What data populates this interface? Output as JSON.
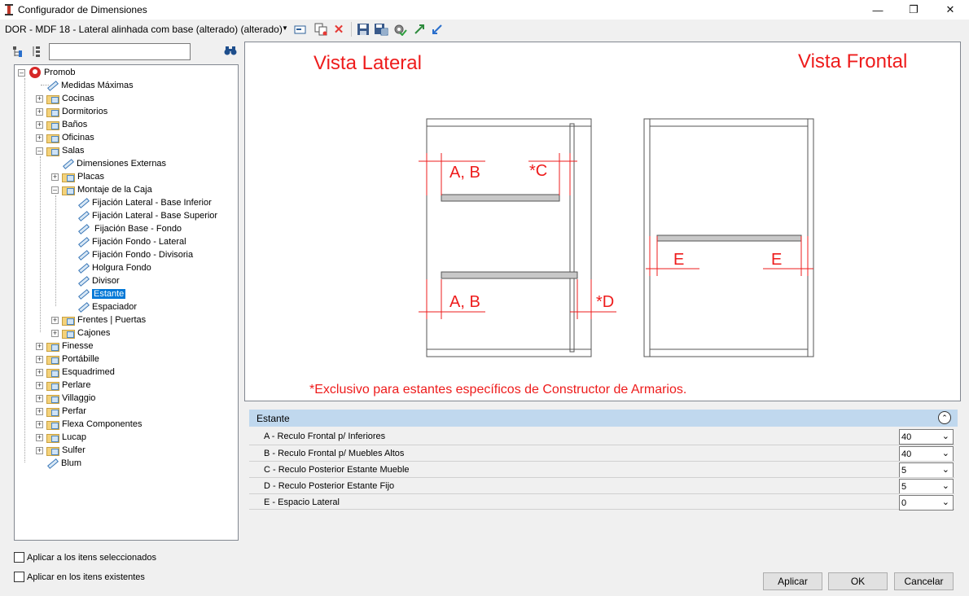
{
  "window": {
    "title": "Configurador de Dimensiones",
    "min_icon": "minimize-icon",
    "max_icon": "restore-icon",
    "close_icon": "close-icon"
  },
  "toolbar": {
    "config_value": "DOR - MDF 18 - Lateral alinhada com base (alterado) (alterado)",
    "icons": [
      "rename-icon",
      "copy-icon",
      "delete-icon",
      "save-icon",
      "save-as-icon",
      "settings-check-icon",
      "expand-icon",
      "collapse-icon"
    ]
  },
  "left": {
    "search_value": "",
    "tree": {
      "root": "Promob",
      "items": {
        "medidas": "Medidas Máximas",
        "cocinas": "Cocinas",
        "dormitorios": "Dormitorios",
        "banos": "Baños",
        "oficinas": "Oficinas",
        "salas": "Salas",
        "dim_ext": "Dimensiones Externas",
        "placas": "Placas",
        "montaje": "Montaje de la Caja",
        "fij_lat_inf": "Fijación Lateral - Base Inferior",
        "fij_lat_sup": "Fijación Lateral - Base Superior",
        "fij_base_fondo": " Fijación Base - Fondo",
        "fij_fondo_lat": "Fijación Fondo - Lateral",
        "fij_fondo_div": "Fijación Fondo - Divisoria",
        "holgura": "Holgura Fondo",
        "divisor": "Divisor",
        "estante": "Estante",
        "espaciador": "Espaciador",
        "frentes": "Frentes | Puertas",
        "cajones": "Cajones",
        "finesse": "Finesse",
        "portabille": "Portábille",
        "esquadrimed": "Esquadrimed",
        "perlare": "Perlare",
        "villaggio": "Villaggio",
        "perfar": "Perfar",
        "flexa": "Flexa Componentes",
        "lucap": "Lucap",
        "sulfer": "Sulfer",
        "blum": "Blum"
      }
    },
    "check1": "Aplicar a los itens seleccionados",
    "check2": "Aplicar en los itens existentes"
  },
  "drawing": {
    "title_left": "Vista Lateral",
    "title_right": "Vista Frontal",
    "label_ab_top": "A, B",
    "label_c": "*C",
    "label_ab_bottom": "A, B",
    "label_d": "*D",
    "label_e_left": "E",
    "label_e_right": "E",
    "note": "*Exclusivo para estantes específicos de Constructor de Armarios."
  },
  "props": {
    "group": "Estante",
    "rows": [
      {
        "name": "A - Reculo Frontal p/ Inferiores",
        "value": "40"
      },
      {
        "name": "B - Reculo Frontal p/ Muebles Altos",
        "value": "40"
      },
      {
        "name": "C - Reculo Posterior Estante Mueble",
        "value": "5"
      },
      {
        "name": "D - Reculo Posterior Estante Fijo",
        "value": "5"
      },
      {
        "name": "E - Espacio Lateral",
        "value": "0"
      }
    ]
  },
  "buttons": {
    "apply": "Aplicar",
    "ok": "OK",
    "cancel": "Cancelar"
  }
}
